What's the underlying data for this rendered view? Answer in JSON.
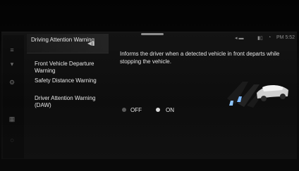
{
  "sidebar": {
    "items": [
      {
        "label": "Driving Attention Warning",
        "icon": "sound-icon"
      },
      {
        "label": "Front Vehicle Departure Warning"
      },
      {
        "label": "Safety Distance Warning"
      },
      {
        "label": "Driver Attention Warning (DAW)"
      }
    ]
  },
  "status_bar": {
    "time": "PM 5:52",
    "icons": [
      "signal-icon",
      "battery-icon",
      "wifi-icon"
    ]
  },
  "main": {
    "description": "Informs the driver when a detected vehicle in front departs while stopping the vehicle.",
    "options": [
      {
        "label": "OFF",
        "selected": false
      },
      {
        "label": "ON",
        "selected": true
      }
    ]
  },
  "colors": {
    "background": "#0d0d0d",
    "text": "#e6e6e6",
    "selected_radio": "#d9d9d9",
    "unselected_radio": "#5a5a5a"
  }
}
